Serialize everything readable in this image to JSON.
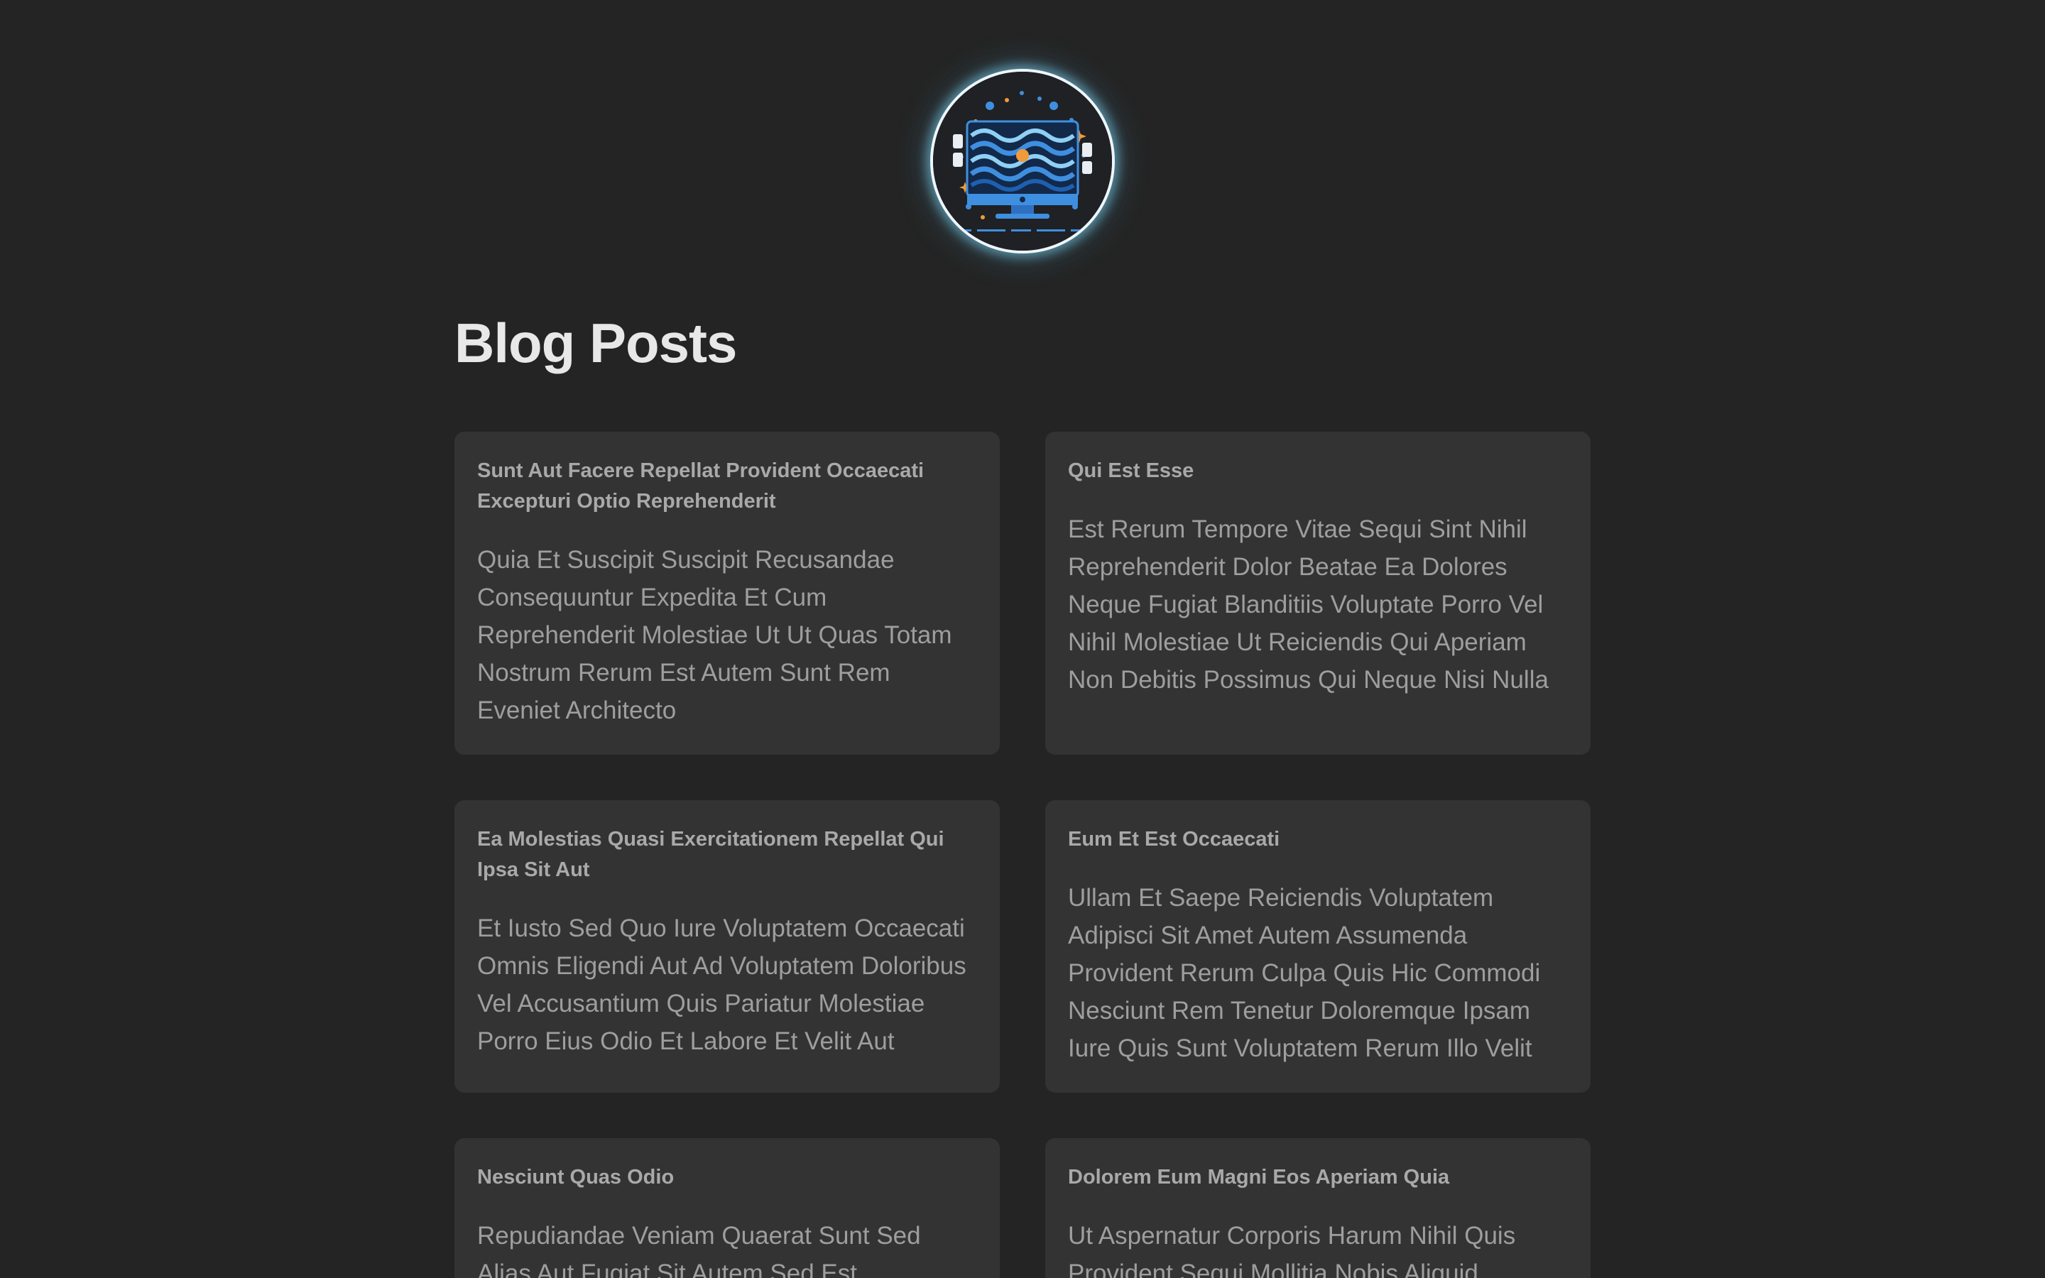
{
  "header": {
    "logo_icon": "monitor-waves-logo-icon"
  },
  "page": {
    "title": "Blog Posts"
  },
  "posts": [
    {
      "title": "Sunt Aut Facere Repellat Provident Occaecati Excepturi Optio Reprehenderit",
      "body": "Quia Et Suscipit Suscipit Recusandae Consequuntur Expedita Et Cum Reprehenderit Molestiae Ut Ut Quas Totam Nostrum Rerum Est Autem Sunt Rem Eveniet Architecto"
    },
    {
      "title": "Qui Est Esse",
      "body": "Est Rerum Tempore Vitae Sequi Sint Nihil Reprehenderit Dolor Beatae Ea Dolores Neque Fugiat Blanditiis Voluptate Porro Vel Nihil Molestiae Ut Reiciendis Qui Aperiam Non Debitis Possimus Qui Neque Nisi Nulla"
    },
    {
      "title": "Ea Molestias Quasi Exercitationem Repellat Qui Ipsa Sit Aut",
      "body": "Et Iusto Sed Quo Iure Voluptatem Occaecati Omnis Eligendi Aut Ad Voluptatem Doloribus Vel Accusantium Quis Pariatur Molestiae Porro Eius Odio Et Labore Et Velit Aut"
    },
    {
      "title": "Eum Et Est Occaecati",
      "body": "Ullam Et Saepe Reiciendis Voluptatem Adipisci Sit Amet Autem Assumenda Provident Rerum Culpa Quis Hic Commodi Nesciunt Rem Tenetur Doloremque Ipsam Iure Quis Sunt Voluptatem Rerum Illo Velit"
    },
    {
      "title": "Nesciunt Quas Odio",
      "body": "Repudiandae Veniam Quaerat Sunt Sed Alias Aut Fugiat Sit Autem Sed Est"
    },
    {
      "title": "Dolorem Eum Magni Eos Aperiam Quia",
      "body": "Ut Aspernatur Corporis Harum Nihil Quis Provident Sequi Mollitia Nobis Aliquid"
    }
  ],
  "colors": {
    "background": "#242424",
    "card": "#333333",
    "title_text": "#e8e8e8",
    "card_title_text": "#a9a9a9",
    "card_body_text": "#9e9e9e",
    "logo_glow": "#78c8e6"
  }
}
